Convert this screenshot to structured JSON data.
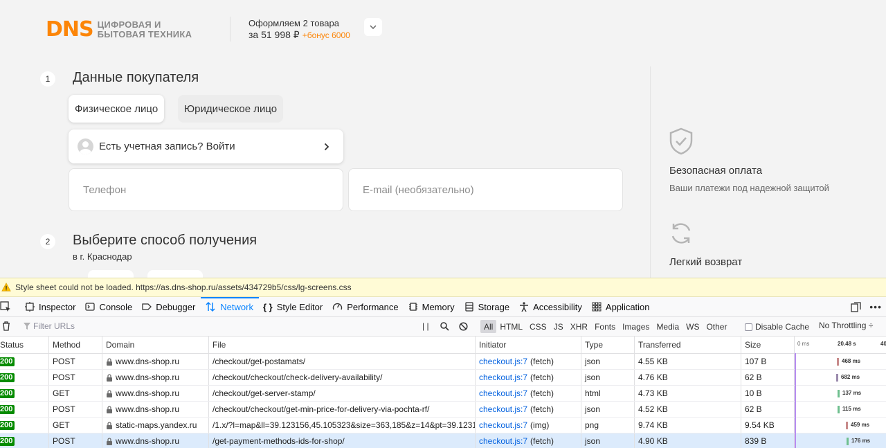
{
  "header": {
    "logo_text": "DNS",
    "logo_tagline_1": "ЦИФРОВАЯ И",
    "logo_tagline_2": "БЫТОВАЯ ТЕХНИКА",
    "order_line1": "Оформляем 2 товара",
    "order_price": "за 51 998 ₽",
    "order_bonus": "+бонус 6000"
  },
  "step1": {
    "number": "1",
    "title": "Данные покупателя",
    "tab_individual": "Физическое лицо",
    "tab_legal": "Юридическое лицо",
    "login_prompt": "Есть учетная запись? Войти",
    "phone_placeholder": "Телефон",
    "email_placeholder": "E-mail (необязательно)"
  },
  "step2": {
    "number": "2",
    "title": "Выберите способ получения",
    "city": "в г. Краснодар"
  },
  "features": [
    {
      "title": "Безопасная оплата",
      "desc": "Ваши платежи под надежной защитой",
      "icon": "shield-check-icon"
    },
    {
      "title": "Легкий возврат",
      "desc": "",
      "icon": "refresh-icon"
    }
  ],
  "devtools": {
    "warning": "Style sheet could not be loaded. https://as.dns-shop.ru/assets/434729b5/css/lg-screens.css",
    "tabs": [
      "Inspector",
      "Console",
      "Debugger",
      "Network",
      "Style Editor",
      "Performance",
      "Memory",
      "Storage",
      "Accessibility",
      "Application"
    ],
    "selected_tab": "Network",
    "filter_placeholder": "Filter URLs",
    "type_filters": [
      "All",
      "HTML",
      "CSS",
      "JS",
      "XHR",
      "Fonts",
      "Images",
      "Media",
      "WS",
      "Other"
    ],
    "disable_cache": "Disable Cache",
    "throttling": "No Throttling ÷",
    "columns": [
      "Status",
      "Method",
      "Domain",
      "File",
      "Initiator",
      "Type",
      "Transferred",
      "Size"
    ],
    "waterfall_ticks": [
      "0 ms",
      "20.48 s",
      "40"
    ],
    "requests": [
      {
        "status": "200",
        "method": "POST",
        "domain": "www.dns-shop.ru",
        "file": "/checkout/get-postamats/",
        "initiator": "checkout.js:7",
        "initiator_type": "(fetch)",
        "type": "json",
        "transferred": "4.55 KB",
        "size": "107 B",
        "time": "468 ms",
        "bar_color": "#c88b8b"
      },
      {
        "status": "200",
        "method": "POST",
        "domain": "www.dns-shop.ru",
        "file": "/checkout/checkout/check-delivery-availability/",
        "initiator": "checkout.js:7",
        "initiator_type": "(fetch)",
        "type": "json",
        "transferred": "4.76 KB",
        "size": "62 B",
        "time": "682 ms",
        "bar_color": "#9b8bad"
      },
      {
        "status": "200",
        "method": "GET",
        "domain": "www.dns-shop.ru",
        "file": "/checkout/get-server-stamp/",
        "initiator": "checkout.js:7",
        "initiator_type": "(fetch)",
        "type": "html",
        "transferred": "4.73 KB",
        "size": "10 B",
        "time": "137 ms",
        "bar_color": "#6fbf8f"
      },
      {
        "status": "200",
        "method": "POST",
        "domain": "www.dns-shop.ru",
        "file": "/checkout/checkout/get-min-price-for-delivery-via-pochta-rf/",
        "initiator": "checkout.js:7",
        "initiator_type": "(fetch)",
        "type": "json",
        "transferred": "4.52 KB",
        "size": "62 B",
        "time": "115 ms",
        "bar_color": "#6fbf8f"
      },
      {
        "status": "200",
        "method": "GET",
        "domain": "static-maps.yandex.ru",
        "file": "/1.x/?l=map&ll=39.123156,45.105323&size=363,185&z=14&pt=39.123156,45",
        "initiator": "checkout.js:7",
        "initiator_type": "(img)",
        "type": "png",
        "transferred": "9.74 KB",
        "size": "9.54 KB",
        "time": "459 ms",
        "bar_color": "#c88b8b"
      },
      {
        "status": "200",
        "method": "POST",
        "domain": "www.dns-shop.ru",
        "file": "/get-payment-methods-ids-for-shop/",
        "initiator": "checkout.js:7",
        "initiator_type": "(fetch)",
        "type": "json",
        "transferred": "4.90 KB",
        "size": "839 B",
        "time": "176 ms",
        "bar_color": "#6fbf8f",
        "selected": true
      }
    ]
  }
}
